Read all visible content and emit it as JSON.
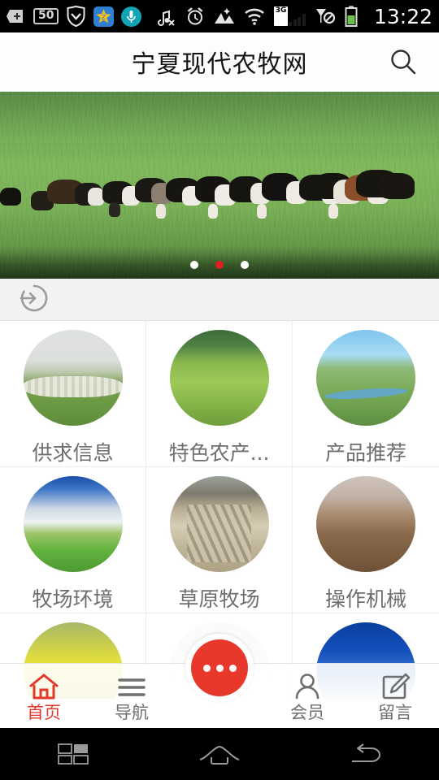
{
  "status_bar": {
    "time": "13:22",
    "battery_badge": "50",
    "network_label": "3G",
    "icons": [
      "download-arrow-icon",
      "battery-50-badge-icon",
      "shield-icon",
      "star-app-icon",
      "microphone-icon",
      "music-off-icon",
      "alarm-clock-icon",
      "photo-icon",
      "wifi-icon",
      "signal-3g-icon",
      "no-sim-icon",
      "battery-icon"
    ]
  },
  "header": {
    "title": "宁夏现代农牧网",
    "search_icon": "search-icon"
  },
  "banner": {
    "alt": "草原牧牛",
    "dots": [
      {
        "active": false
      },
      {
        "active": true
      },
      {
        "active": false
      }
    ]
  },
  "history_bar": {
    "icon": "history-arrow-icon"
  },
  "grid": {
    "items": [
      {
        "label": "供求信息",
        "scene": "sc-sheepfog"
      },
      {
        "label": "特色农产...",
        "scene": "sc-cowsgreen"
      },
      {
        "label": "产品推荐",
        "scene": "sc-steppe"
      },
      {
        "label": "牧场环境",
        "scene": "sc-cloudgrass"
      },
      {
        "label": "草原牧场",
        "scene": "sc-barn"
      },
      {
        "label": "操作机械",
        "scene": "sc-brown"
      },
      {
        "label": "",
        "scene": "sc-canola"
      },
      {
        "label": "",
        "scene": "sc-blank"
      },
      {
        "label": "",
        "scene": "sc-bluesky"
      }
    ]
  },
  "tabbar": {
    "items": [
      {
        "label": "首页",
        "icon": "home-icon",
        "active": true
      },
      {
        "label": "导航",
        "icon": "menu-lines-icon",
        "active": false
      },
      {
        "label": "会员",
        "icon": "user-icon",
        "active": false
      },
      {
        "label": "留言",
        "icon": "edit-pencil-icon",
        "active": false
      }
    ],
    "fab": {
      "icon": "more-dots-icon"
    }
  },
  "android_nav": {
    "buttons": [
      {
        "icon": "recents-icon"
      },
      {
        "icon": "home-icon"
      },
      {
        "icon": "back-icon"
      }
    ]
  },
  "colors": {
    "accent_red": "#e0392c",
    "fab_red": "#e8382c",
    "label_gray": "#6e6e6e",
    "header_bg": "#fdfdfd",
    "page_bg": "#ffffff"
  }
}
